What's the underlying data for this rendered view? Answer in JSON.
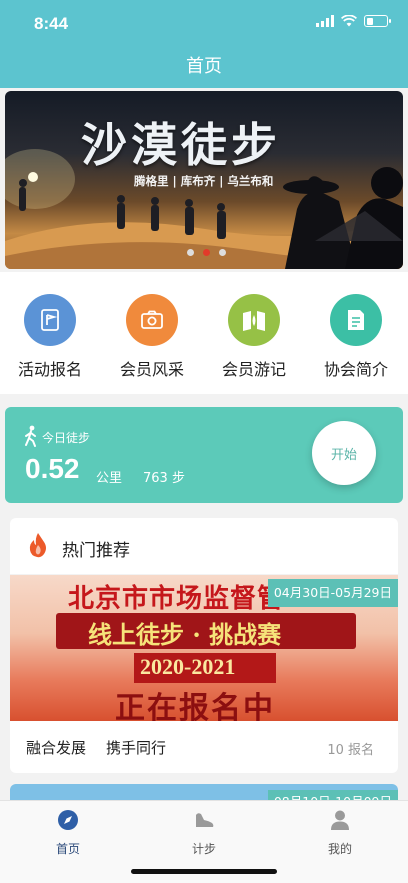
{
  "status_bar": {
    "time": "8:44"
  },
  "header": {
    "title": "首页"
  },
  "banner": {
    "title": "沙漠徒步",
    "subtitle": "腾格里 | 库布齐 | 乌兰布和",
    "dots": 3,
    "active_dot": 2
  },
  "quick_menu": {
    "items": [
      {
        "label": "活动报名",
        "icon": "flag-doc-icon",
        "color": "#5b93d6"
      },
      {
        "label": "会员风采",
        "icon": "camera-icon",
        "color": "#f08a3c"
      },
      {
        "label": "会员游记",
        "icon": "travel-book-icon",
        "color": "#96c146"
      },
      {
        "label": "协会简介",
        "icon": "document-icon",
        "color": "#3cbfa5"
      }
    ]
  },
  "steps": {
    "label": "今日徒步",
    "distance": "0.52",
    "distance_unit": "公里",
    "step_count": "763 步",
    "start_label": "开始"
  },
  "hot": {
    "title": "热门推荐",
    "events": [
      {
        "date_range": "04月30日-05月29日",
        "poster": {
          "line1": "北京市市场监督管",
          "line2": "线上徒步 · 挑战赛",
          "year": "2020-2021",
          "line3": "正在报名中"
        },
        "tags": [
          "融合发展",
          "携手同行"
        ],
        "signups": "10 报名"
      },
      {
        "date_range": "08月10日-10月09日"
      }
    ]
  },
  "tabbar": {
    "items": [
      {
        "label": "首页",
        "icon": "compass-icon",
        "active": true
      },
      {
        "label": "计步",
        "icon": "shoe-icon",
        "active": false
      },
      {
        "label": "我的",
        "icon": "person-icon",
        "active": false
      }
    ]
  },
  "colors": {
    "primary": "#5cc4cf",
    "steps_card": "#5ccab9",
    "badge": "#5cc0b6",
    "active_dot": "#e23a2a"
  }
}
